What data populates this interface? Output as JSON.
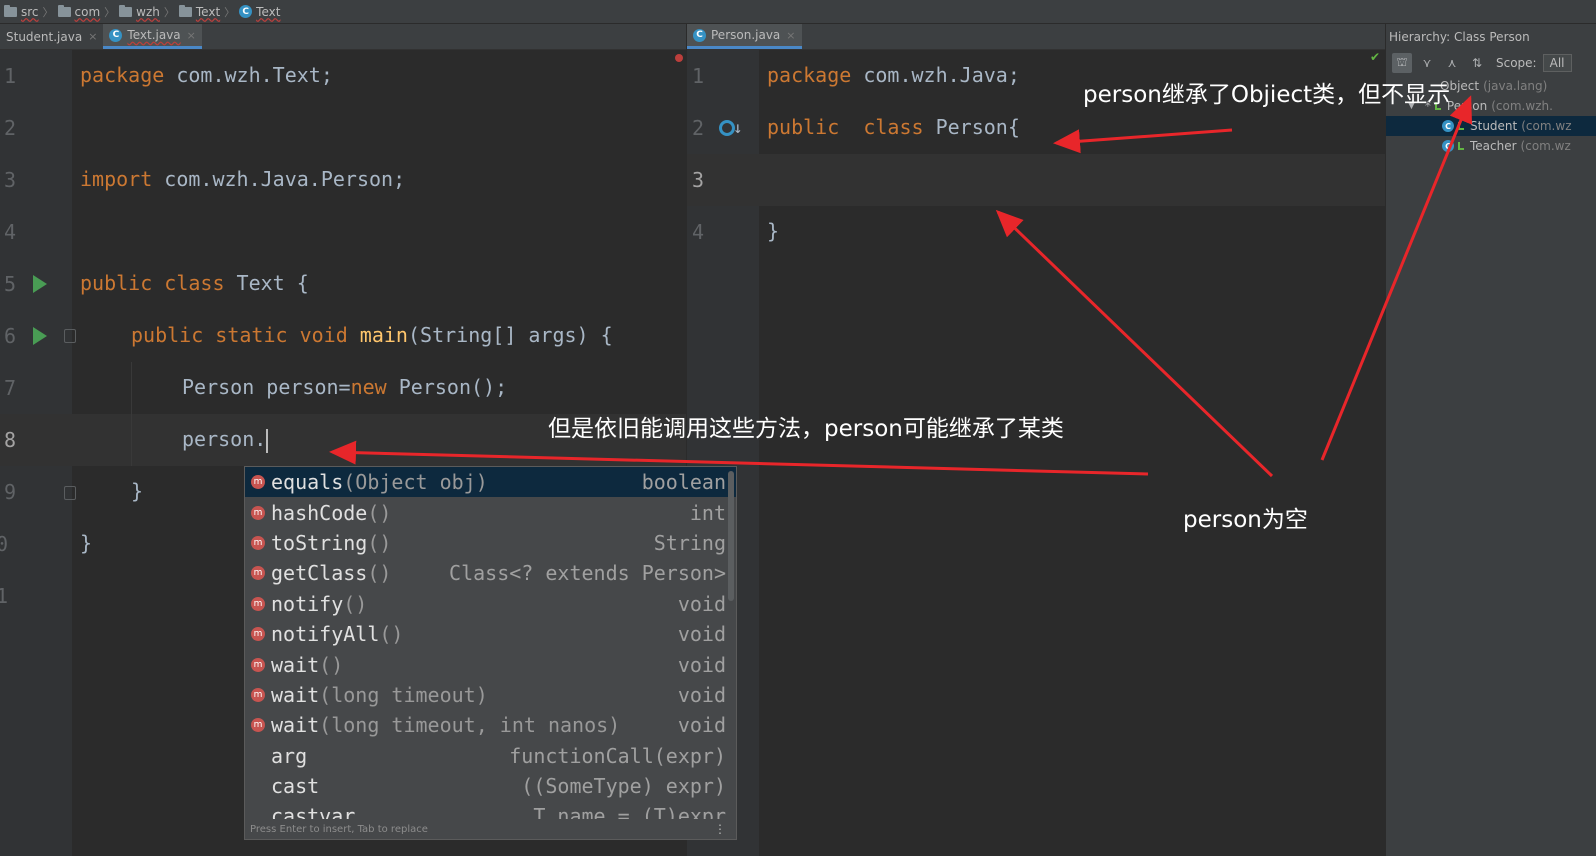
{
  "breadcrumb": [
    {
      "label": "src",
      "icon": "folder-icon"
    },
    {
      "label": "com",
      "icon": "folder-icon"
    },
    {
      "label": "wzh",
      "icon": "folder-icon"
    },
    {
      "label": "Text",
      "icon": "folder-icon"
    },
    {
      "label": "Text",
      "icon": "class-icon",
      "icon_char": "C"
    }
  ],
  "left_tabs": [
    {
      "label": "Student.java",
      "active": false,
      "close": "×"
    },
    {
      "label": "Text.java",
      "active": true,
      "close": "×",
      "icon_char": "C"
    }
  ],
  "right_tabs": [
    {
      "label": "Person.java",
      "active": true,
      "close": "×",
      "icon_char": "C"
    }
  ],
  "left_editor": {
    "line_numbers": [
      "1",
      "2",
      "3",
      "4",
      "5",
      "6",
      "7",
      "8",
      "9",
      "0",
      "1"
    ],
    "current_line": "8",
    "lines": {
      "l1": {
        "kw": "package",
        "rest": " com.wzh.Text;"
      },
      "l3": {
        "kw": "import",
        "rest": " com.wzh.Java.Person;"
      },
      "l5": {
        "kw1": "public",
        "kw2": " class",
        "rest": " Text {"
      },
      "l6": {
        "kw1": "public",
        "kw2": " static",
        "kw3": " void",
        "fn": " main",
        "rest": "(String[] args) {"
      },
      "l7": {
        "pre": "Person person=",
        "kw": "new",
        "rest": " Person();"
      },
      "l8": {
        "text": "person."
      },
      "l9": {
        "text": "}"
      },
      "l10": {
        "text": "}"
      }
    }
  },
  "right_editor": {
    "line_numbers": [
      "1",
      "2",
      "3",
      "4"
    ],
    "lines": {
      "l1": {
        "kw": "package",
        "rest": " com.wzh.Java;"
      },
      "l2": {
        "kw1": "public",
        "kw2": "  class",
        "rest": " Person{"
      },
      "l4": {
        "text": "}"
      }
    }
  },
  "completion": {
    "items": [
      {
        "name": "equals",
        "params": "(Object obj)",
        "type": "boolean",
        "icon": "m",
        "selected": true
      },
      {
        "name": "hashCode",
        "params": "()",
        "type": "int",
        "icon": "m"
      },
      {
        "name": "toString",
        "params": "()",
        "type": "String",
        "icon": "m"
      },
      {
        "name": "getClass",
        "params": "()",
        "type": "Class<? extends Person>",
        "icon": "m"
      },
      {
        "name": "notify",
        "params": "()",
        "type": "void",
        "icon": "m"
      },
      {
        "name": "notifyAll",
        "params": "()",
        "type": "void",
        "icon": "m"
      },
      {
        "name": "wait",
        "params": "()",
        "type": "void",
        "icon": "m"
      },
      {
        "name": "wait",
        "params": "(long timeout)",
        "type": "void",
        "icon": "m"
      },
      {
        "name": "wait",
        "params": "(long timeout, int nanos)",
        "type": "void",
        "icon": "m"
      },
      {
        "name": "arg",
        "params": "",
        "type": "functionCall(expr)",
        "icon": ""
      },
      {
        "name": "cast",
        "params": "",
        "type": "((SomeType) expr)",
        "icon": ""
      },
      {
        "name": "castvar",
        "params": "",
        "type": "T name = (T)expr",
        "icon": ""
      }
    ],
    "footer": "Press Enter to insert, Tab to replace",
    "more": "⋮"
  },
  "hierarchy": {
    "title": "Hierarchy:  Class Person",
    "scope_label": "Scope:",
    "scope_value": "All",
    "tree": [
      {
        "name": "Object",
        "pkg": "(java.lang)",
        "level": 0,
        "expander": ""
      },
      {
        "name": "Person",
        "pkg": "(com.wzh.",
        "level": 1,
        "expander": "▼",
        "mark": "*"
      },
      {
        "name": "Student",
        "pkg": "(com.wz",
        "level": 2,
        "selected": true,
        "icon_char": "C"
      },
      {
        "name": "Teacher",
        "pkg": "(com.wz",
        "level": 2,
        "icon_char": "C"
      }
    ],
    "check": "✔"
  },
  "annotations": {
    "object_note": "person继承了Objiect类，但不显示",
    "methods_note": "但是依旧能调用这些方法，person可能继承了某类",
    "empty_note": "person为空"
  },
  "colors": {
    "keyword": "#cc7832",
    "function": "#ffc66d",
    "text": "#a9b7c6",
    "arrow": "#e8262a"
  }
}
